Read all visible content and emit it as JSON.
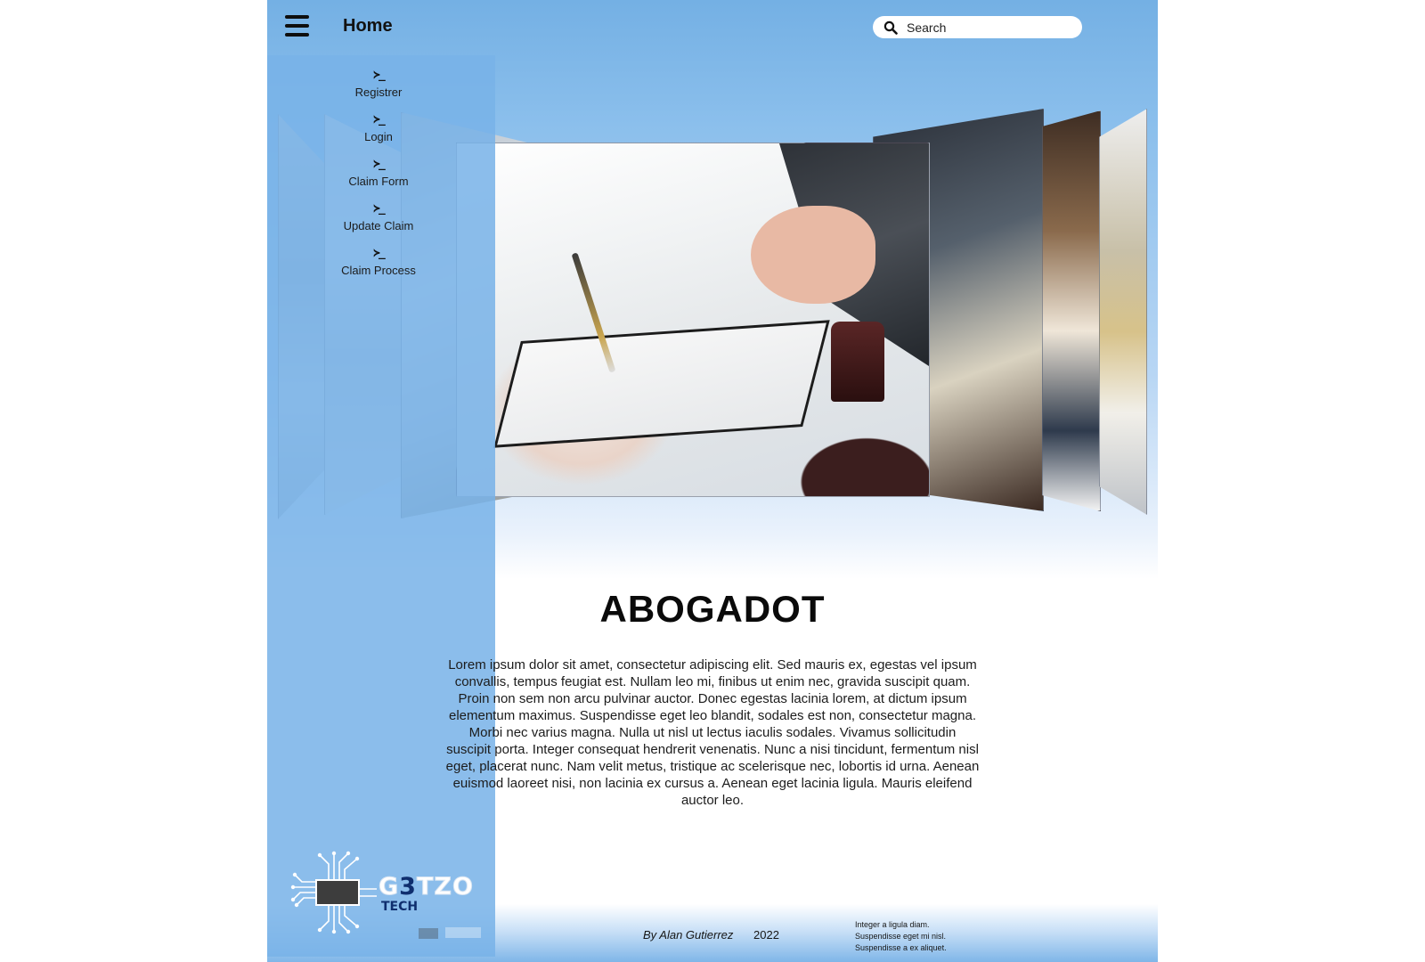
{
  "header": {
    "home_label": "Home",
    "search_placeholder": "Search"
  },
  "sidebar": {
    "items": [
      {
        "label": "Registrer"
      },
      {
        "label": "Login"
      },
      {
        "label": "Claim Form"
      },
      {
        "label": "Update Claim"
      },
      {
        "label": "Claim Process"
      }
    ],
    "item_glyph": "≻_"
  },
  "logo": {
    "brand_prefix": "G",
    "brand_highlight": "3",
    "brand_suffix": "TZO",
    "subtitle": "TECH"
  },
  "main": {
    "title": "ABOGADOT",
    "body": "Lorem ipsum dolor sit amet, consectetur adipiscing elit. Sed mauris ex, egestas vel ipsum convallis, tempus feugiat est. Nullam leo mi, finibus ut enim nec, gravida suscipit quam. Proin non sem non arcu pulvinar auctor. Donec egestas lacinia lorem, at dictum ipsum elementum maximus. Suspendisse eget leo blandit, sodales est non, consectetur magna. Morbi nec varius magna. Nulla ut nisl ut lectus iaculis sodales. Vivamus sollicitudin suscipit porta. Integer consequat hendrerit venenatis. Nunc a nisi tincidunt, fermentum nisl eget, placerat nunc. Nam velit metus, tristique ac scelerisque nec, lobortis id urna. Aenean euismod laoreet nisi, non lacinia ex cursus a. Aenean eget lacinia ligula. Mauris eleifend auctor leo."
  },
  "footer": {
    "author": "By Alan Gutierrez",
    "year": "2022",
    "notes": [
      "Integer a ligula diam.",
      "Suspendisse eget mi nisl.",
      "Suspendisse a ex aliquet."
    ]
  },
  "colors": {
    "header_blue": "#74b0e4",
    "sidebar_blue": "#78b2e8",
    "logo_navy": "#0f2e6e"
  },
  "icons": {
    "menu": "hamburger-icon",
    "search": "search-icon",
    "menu_item": "terminal-prompt-icon"
  }
}
